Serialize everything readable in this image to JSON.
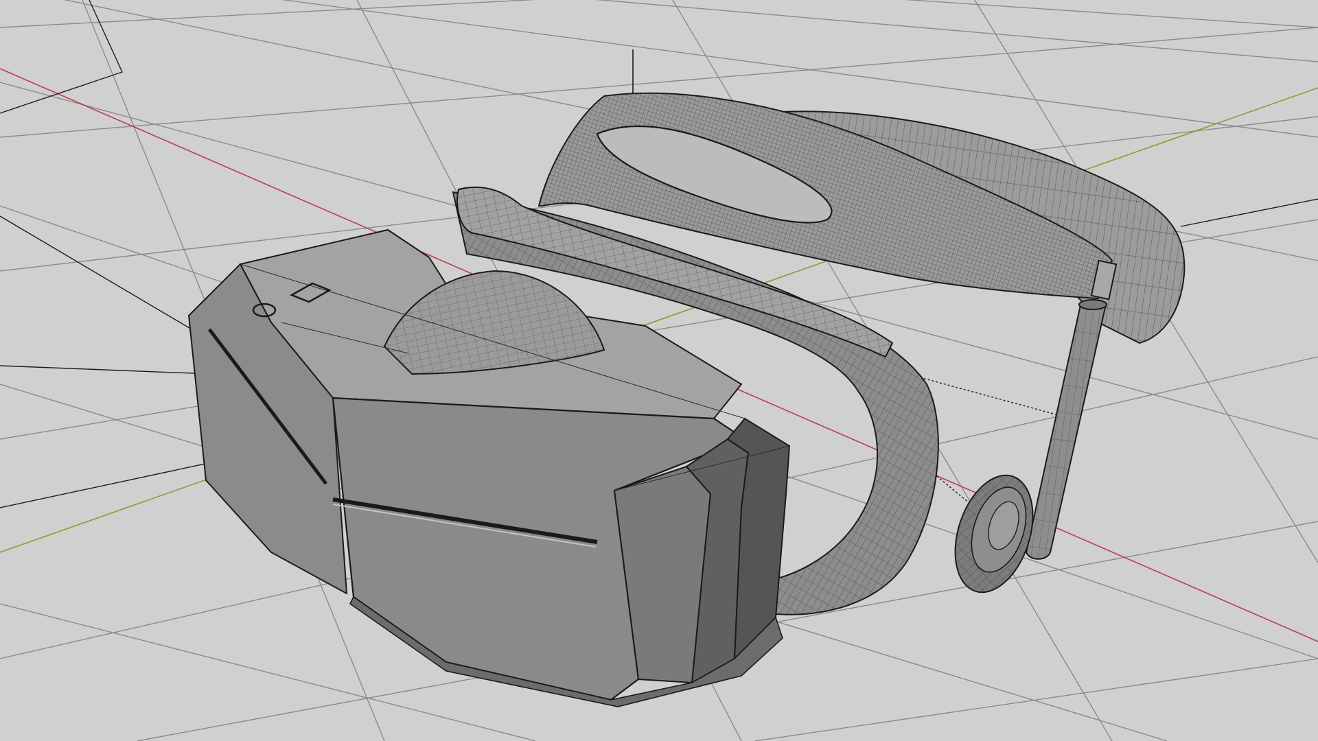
{
  "viewport": {
    "kind": "perspective-3d-viewport",
    "model": "vr-headset-wireframe",
    "display_mode": "shaded-with-wireframe",
    "colors": {
      "background": "#d0d0d0",
      "grid_line": "#8a8a8a",
      "x_axis": "#b8404a",
      "y_axis": "#7fa230",
      "wire": "#1a1a1a",
      "body_light": "#9a9a9a",
      "body_mid": "#828282",
      "body_dark": "#5e5e5e",
      "cushion": "#8d8d8d",
      "strap": "#969696"
    },
    "visible_text": []
  }
}
